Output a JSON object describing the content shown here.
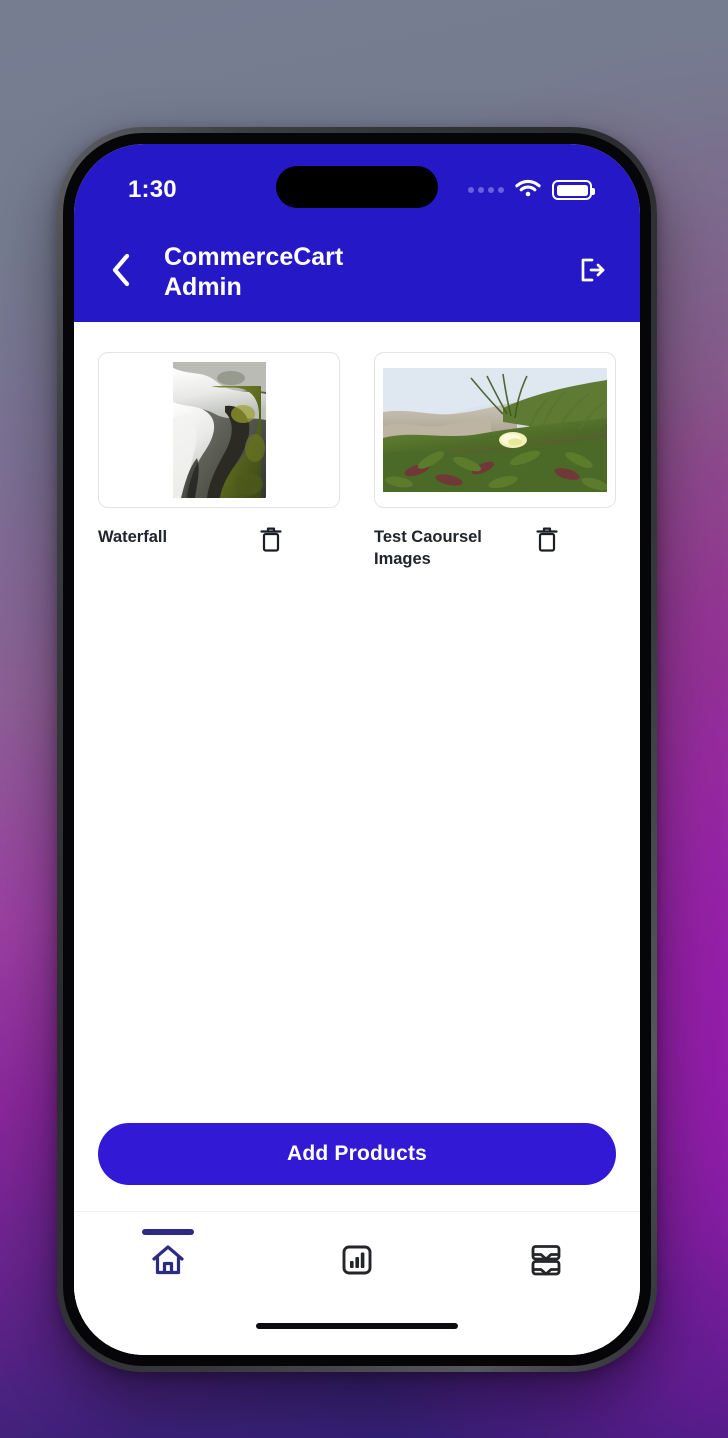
{
  "wallpaper": {
    "gradient_colors": [
      "#777e92",
      "#8c4a7c",
      "#8a1f9e",
      "#2a1e70"
    ]
  },
  "theme": {
    "header_blue": "#2519c7",
    "button_blue": "#3119d6",
    "nav_active": "#2a2b86",
    "text_dark": "#20242b"
  },
  "status_bar": {
    "time": "1:30",
    "signal_icon": "signal-dots-icon",
    "wifi_icon": "wifi-icon",
    "battery_icon": "battery-full-icon"
  },
  "header": {
    "back_icon": "chevron-left-icon",
    "title": "CommerceCart Admin",
    "title_line_1": "CommerceCart",
    "title_line_2": "Admin",
    "logout_icon": "logout-icon"
  },
  "products": [
    {
      "name": "Waterfall",
      "thumbnail": "waterfall-photo",
      "delete_icon": "trash-icon"
    },
    {
      "name": "Test Caoursel Images",
      "thumbnail": "dune-flowers-photo",
      "delete_icon": "trash-icon"
    }
  ],
  "actions": {
    "add_products_label": "Add Products"
  },
  "bottom_nav": {
    "items": [
      {
        "icon": "home-icon",
        "active": true
      },
      {
        "icon": "bar-chart-icon",
        "active": false
      },
      {
        "icon": "inbox-trays-icon",
        "active": false
      }
    ]
  }
}
